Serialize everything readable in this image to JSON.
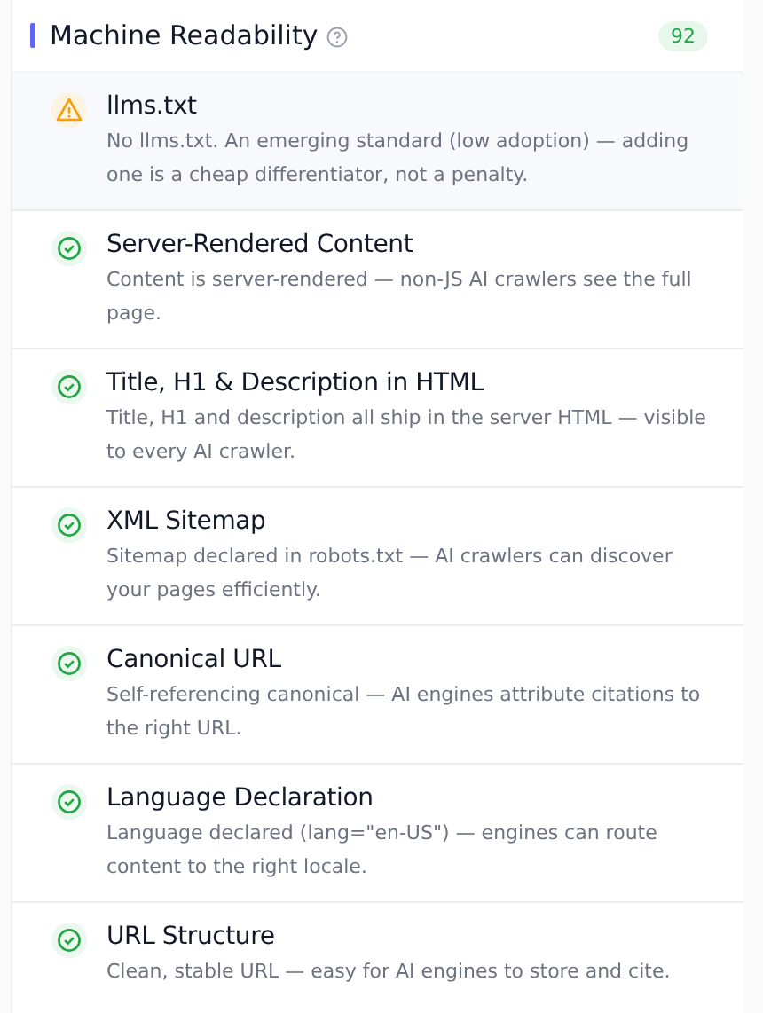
{
  "section": {
    "title": "Machine Readability",
    "score": "92"
  },
  "checks": [
    {
      "kind": "warning",
      "title": "llms.txt",
      "description": "No llms.txt. An emerging standard (low adoption) — adding one is a cheap differentiator, not a penalty."
    },
    {
      "kind": "pass",
      "title": "Server-Rendered Content",
      "description": "Content is server-rendered — non-JS AI crawlers see the full page."
    },
    {
      "kind": "pass",
      "title": "Title, H1 & Description in HTML",
      "description": "Title, H1 and description all ship in the server HTML — visible to every AI crawler."
    },
    {
      "kind": "pass",
      "title": "XML Sitemap",
      "description": "Sitemap declared in robots.txt — AI crawlers can discover your pages efficiently."
    },
    {
      "kind": "pass",
      "title": "Canonical URL",
      "description": "Self-referencing canonical — AI engines attribute citations to the right URL."
    },
    {
      "kind": "pass",
      "title": "Language Declaration",
      "description": "Language declared (lang=\"en-US\") — engines can route content to the right locale."
    },
    {
      "kind": "pass",
      "title": "URL Structure",
      "description": "Clean, stable URL — easy for AI engines to store and cite."
    }
  ]
}
